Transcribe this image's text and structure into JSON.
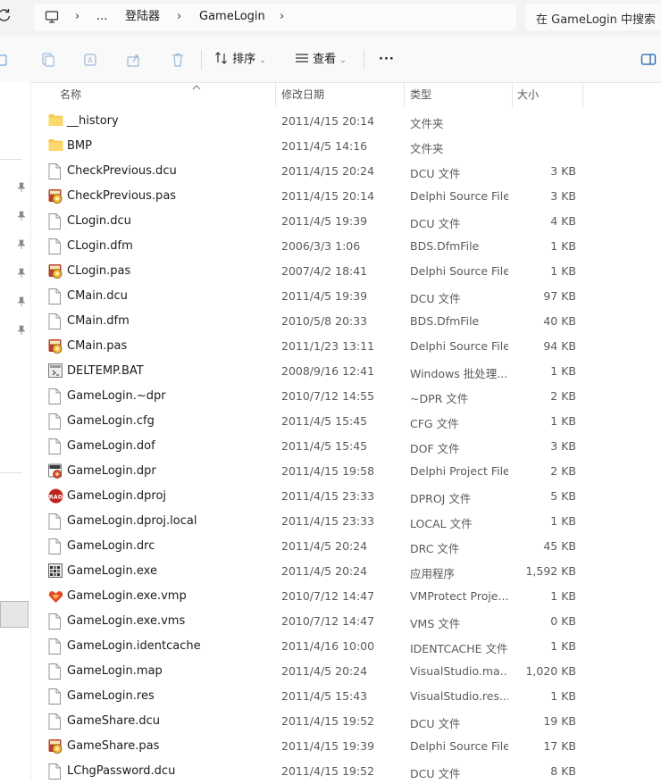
{
  "address": {
    "crumbs": [
      "...",
      "登陆器",
      "GameLogin"
    ],
    "search_placeholder": "在 GameLogin 中搜索"
  },
  "toolbar": {
    "sort_label": "排序",
    "view_label": "查看",
    "more_label": "···"
  },
  "columns": {
    "name": "名称",
    "date": "修改日期",
    "type": "类型",
    "size": "大小"
  },
  "files": [
    {
      "name": "__history",
      "date": "2011/4/15 20:14",
      "type": "文件夹",
      "size": "",
      "icon": "folder-icon"
    },
    {
      "name": "BMP",
      "date": "2011/4/5 14:16",
      "type": "文件夹",
      "size": "",
      "icon": "folder-icon"
    },
    {
      "name": "CheckPrevious.dcu",
      "date": "2011/4/15 20:24",
      "type": "DCU 文件",
      "size": "3 KB",
      "icon": "file-icon"
    },
    {
      "name": "CheckPrevious.pas",
      "date": "2011/4/15 20:14",
      "type": "Delphi Source File",
      "size": "3 KB",
      "icon": "pas-icon"
    },
    {
      "name": "CLogin.dcu",
      "date": "2011/4/5 19:39",
      "type": "DCU 文件",
      "size": "4 KB",
      "icon": "file-icon"
    },
    {
      "name": "CLogin.dfm",
      "date": "2006/3/3 1:06",
      "type": "BDS.DfmFile",
      "size": "1 KB",
      "icon": "file-icon"
    },
    {
      "name": "CLogin.pas",
      "date": "2007/4/2 18:41",
      "type": "Delphi Source File",
      "size": "1 KB",
      "icon": "pas-icon"
    },
    {
      "name": "CMain.dcu",
      "date": "2011/4/5 19:39",
      "type": "DCU 文件",
      "size": "97 KB",
      "icon": "file-icon"
    },
    {
      "name": "CMain.dfm",
      "date": "2010/5/8 20:33",
      "type": "BDS.DfmFile",
      "size": "40 KB",
      "icon": "file-icon"
    },
    {
      "name": "CMain.pas",
      "date": "2011/1/23 13:11",
      "type": "Delphi Source File",
      "size": "94 KB",
      "icon": "pas-icon"
    },
    {
      "name": "DELTEMP.BAT",
      "date": "2008/9/16 12:41",
      "type": "Windows 批处理...",
      "size": "1 KB",
      "icon": "bat-icon"
    },
    {
      "name": "GameLogin.~dpr",
      "date": "2010/7/12 14:55",
      "type": "~DPR 文件",
      "size": "2 KB",
      "icon": "file-icon"
    },
    {
      "name": "GameLogin.cfg",
      "date": "2011/4/5 15:45",
      "type": "CFG 文件",
      "size": "1 KB",
      "icon": "file-icon"
    },
    {
      "name": "GameLogin.dof",
      "date": "2011/4/5 15:45",
      "type": "DOF 文件",
      "size": "3 KB",
      "icon": "file-icon"
    },
    {
      "name": "GameLogin.dpr",
      "date": "2011/4/15 19:58",
      "type": "Delphi Project File",
      "size": "2 KB",
      "icon": "dpr-icon"
    },
    {
      "name": "GameLogin.dproj",
      "date": "2011/4/15 23:33",
      "type": "DPROJ 文件",
      "size": "5 KB",
      "icon": "rad-icon"
    },
    {
      "name": "GameLogin.dproj.local",
      "date": "2011/4/15 23:33",
      "type": "LOCAL 文件",
      "size": "1 KB",
      "icon": "file-icon"
    },
    {
      "name": "GameLogin.drc",
      "date": "2011/4/5 20:24",
      "type": "DRC 文件",
      "size": "45 KB",
      "icon": "file-icon"
    },
    {
      "name": "GameLogin.exe",
      "date": "2011/4/5 20:24",
      "type": "应用程序",
      "size": "1,592 KB",
      "icon": "exe-icon"
    },
    {
      "name": "GameLogin.exe.vmp",
      "date": "2010/7/12 14:47",
      "type": "VMProtect Proje...",
      "size": "1 KB",
      "icon": "vmp-icon"
    },
    {
      "name": "GameLogin.exe.vms",
      "date": "2010/7/12 14:47",
      "type": "VMS 文件",
      "size": "0 KB",
      "icon": "file-icon"
    },
    {
      "name": "GameLogin.identcache",
      "date": "2011/4/16 10:00",
      "type": "IDENTCACHE 文件",
      "size": "1 KB",
      "icon": "file-icon"
    },
    {
      "name": "GameLogin.map",
      "date": "2011/4/5 20:24",
      "type": "VisualStudio.ma...",
      "size": "1,020 KB",
      "icon": "file-icon"
    },
    {
      "name": "GameLogin.res",
      "date": "2011/4/5 15:43",
      "type": "VisualStudio.res....",
      "size": "1 KB",
      "icon": "file-icon"
    },
    {
      "name": "GameShare.dcu",
      "date": "2011/4/15 19:52",
      "type": "DCU 文件",
      "size": "19 KB",
      "icon": "file-icon"
    },
    {
      "name": "GameShare.pas",
      "date": "2011/4/15 19:39",
      "type": "Delphi Source File",
      "size": "17 KB",
      "icon": "pas-icon"
    },
    {
      "name": "LChgPassword.dcu",
      "date": "2011/4/15 19:52",
      "type": "DCU 文件",
      "size": "8 KB",
      "icon": "file-icon"
    }
  ]
}
